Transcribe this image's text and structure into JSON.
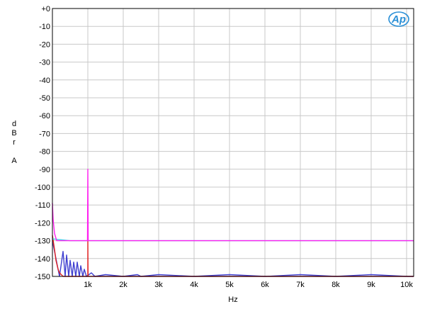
{
  "chart_data": {
    "type": "line",
    "title": "",
    "xlabel": "Hz",
    "ylabel_lines": [
      "d",
      "B",
      "r",
      "",
      "A"
    ],
    "xlim": [
      0,
      10200
    ],
    "ylim": [
      -150,
      0
    ],
    "grid": true,
    "x_ticks": [
      {
        "value": 1000,
        "label": "1k"
      },
      {
        "value": 2000,
        "label": "2k"
      },
      {
        "value": 3000,
        "label": "3k"
      },
      {
        "value": 4000,
        "label": "4k"
      },
      {
        "value": 5000,
        "label": "5k"
      },
      {
        "value": 6000,
        "label": "6k"
      },
      {
        "value": 7000,
        "label": "7k"
      },
      {
        "value": 8000,
        "label": "8k"
      },
      {
        "value": 9000,
        "label": "9k"
      },
      {
        "value": 10000,
        "label": "10k"
      }
    ],
    "y_ticks": [
      {
        "value": 0,
        "label": "+0"
      },
      {
        "value": -10,
        "label": "-10"
      },
      {
        "value": -20,
        "label": "-20"
      },
      {
        "value": -30,
        "label": "-30"
      },
      {
        "value": -40,
        "label": "-40"
      },
      {
        "value": -50,
        "label": "-50"
      },
      {
        "value": -60,
        "label": "-60"
      },
      {
        "value": -70,
        "label": "-70"
      },
      {
        "value": -80,
        "label": "-80"
      },
      {
        "value": -90,
        "label": "-90"
      },
      {
        "value": -100,
        "label": "-100"
      },
      {
        "value": -110,
        "label": "-110"
      },
      {
        "value": -120,
        "label": "-120"
      },
      {
        "value": -130,
        "label": "-130"
      },
      {
        "value": -140,
        "label": "-140"
      },
      {
        "value": -150,
        "label": "-150"
      }
    ],
    "series": [
      {
        "color": "#3f3fd0",
        "points": [
          [
            0,
            -130
          ],
          [
            200,
            -150
          ],
          [
            300,
            -136
          ],
          [
            360,
            -150
          ],
          [
            400,
            -138
          ],
          [
            460,
            -150
          ],
          [
            500,
            -141
          ],
          [
            560,
            -150
          ],
          [
            600,
            -142
          ],
          [
            660,
            -150
          ],
          [
            700,
            -142
          ],
          [
            760,
            -150
          ],
          [
            800,
            -144
          ],
          [
            860,
            -150
          ],
          [
            900,
            -146
          ],
          [
            960,
            -150
          ],
          [
            1100,
            -148
          ],
          [
            1200,
            -150
          ],
          [
            1500,
            -149
          ],
          [
            2000,
            -150
          ],
          [
            2400,
            -149
          ],
          [
            2500,
            -150
          ],
          [
            3000,
            -149
          ],
          [
            4000,
            -150
          ],
          [
            5000,
            -149
          ],
          [
            6000,
            -150
          ],
          [
            7000,
            -149
          ],
          [
            8000,
            -150
          ],
          [
            9000,
            -149
          ],
          [
            10000,
            -150
          ],
          [
            10200,
            -150
          ]
        ]
      },
      {
        "color": "#e02020",
        "points": [
          [
            0,
            -127
          ],
          [
            60,
            -135
          ],
          [
            100,
            -141
          ],
          [
            160,
            -146
          ],
          [
            200,
            -148
          ],
          [
            300,
            -150
          ],
          [
            1000,
            -150
          ],
          [
            1000,
            -130
          ],
          [
            1005,
            -150
          ],
          [
            2000,
            -150
          ],
          [
            3000,
            -150
          ],
          [
            4000,
            -150
          ],
          [
            5000,
            -150
          ],
          [
            6000,
            -150
          ],
          [
            7000,
            -150
          ],
          [
            8000,
            -150
          ],
          [
            9000,
            -150
          ],
          [
            10000,
            -150
          ],
          [
            10200,
            -150
          ]
        ]
      },
      {
        "color": "#40d8e8",
        "points": [
          [
            0,
            -129
          ],
          [
            500,
            -130
          ],
          [
            1000,
            -130
          ],
          [
            1500,
            -130
          ],
          [
            2000,
            -130
          ],
          [
            3000,
            -130
          ],
          [
            4000,
            -130
          ],
          [
            5000,
            -130
          ],
          [
            6000,
            -130
          ],
          [
            7000,
            -130
          ],
          [
            8000,
            -130
          ],
          [
            9000,
            -130
          ],
          [
            10000,
            -130
          ],
          [
            10200,
            -130
          ]
        ]
      },
      {
        "color": "#ff20f0",
        "points": [
          [
            0,
            -109
          ],
          [
            20,
            -118
          ],
          [
            60,
            -126
          ],
          [
            120,
            -130
          ],
          [
            500,
            -130
          ],
          [
            990,
            -130
          ],
          [
            1000,
            -90
          ],
          [
            1010,
            -130
          ],
          [
            2000,
            -130
          ],
          [
            3000,
            -130
          ],
          [
            4000,
            -130
          ],
          [
            5000,
            -130
          ],
          [
            6000,
            -130
          ],
          [
            7000,
            -130
          ],
          [
            8000,
            -130
          ],
          [
            9000,
            -130
          ],
          [
            10000,
            -130
          ],
          [
            10200,
            -130
          ]
        ]
      }
    ],
    "logo_text": "Ap",
    "colors": {
      "grid": "#c8c8c8",
      "axis": "#000000",
      "logo": "#2a8fd6"
    }
  }
}
